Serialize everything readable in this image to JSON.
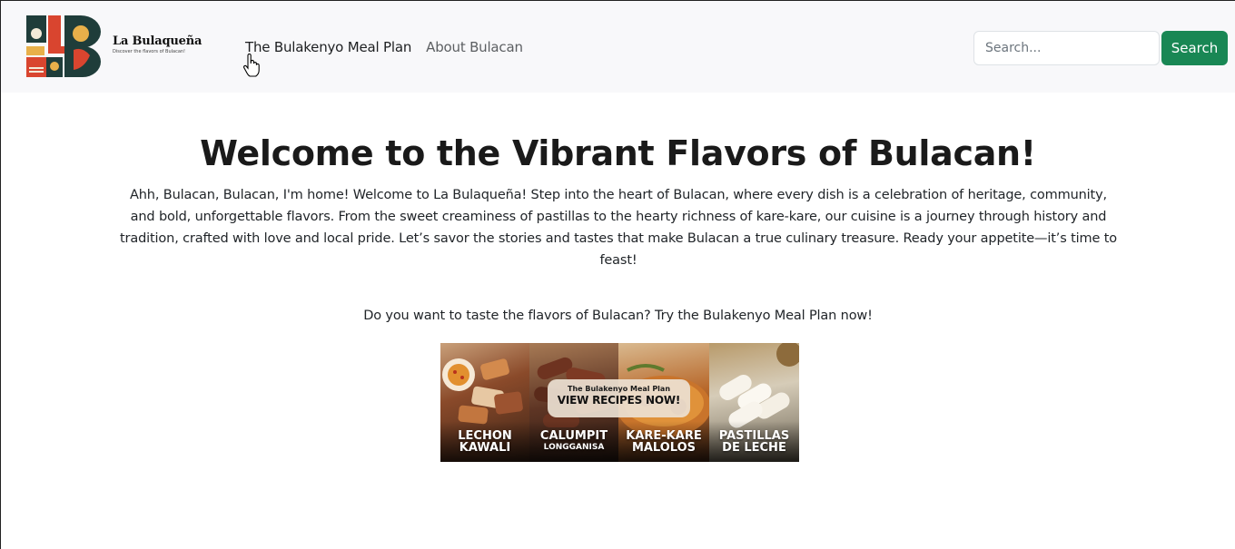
{
  "brand": {
    "name": "La Bulaqueña",
    "tagline": "Discover the flavors of Bulacan!"
  },
  "nav": {
    "links": [
      {
        "label": "The Bulakenyo Meal Plan"
      },
      {
        "label": "About Bulacan"
      }
    ]
  },
  "search": {
    "placeholder": "Search...",
    "value": "",
    "button_label": "Search"
  },
  "main": {
    "title": "Welcome to the Vibrant Flavors of Bulacan!",
    "intro": "Ahh, Bulacan, Bulacan, I'm home! Welcome to La Bulaqueña! Step into the heart of Bulacan, where every dish is a celebration of heritage, community, and bold, unforgettable flavors. From the sweet creaminess of pastillas to the hearty richness of kare-kare, our cuisine is a journey through history and tradition, crafted with love and local pride. Let’s savor the stories and tastes that make Bulacan a true culinary treasure. Ready your appetite—it’s time to feast!",
    "cta": "Do you want to taste the flavors of Bulacan? Try the Bulakenyo Meal Plan now!"
  },
  "banner": {
    "badge_top": "The Bulakenyo Meal Plan",
    "badge_main": "VIEW RECIPES NOW!",
    "panels": [
      {
        "line1": "LECHON",
        "line2": "KAWALI"
      },
      {
        "line1": "CALUMPIT",
        "line2": "LONGGANISA"
      },
      {
        "line1": "KARE-KARE",
        "line2": "MALOLOS"
      },
      {
        "line1": "PASTILLAS",
        "line2": "DE LECHE"
      }
    ]
  },
  "colors": {
    "navbar_bg": "#f8f8fa",
    "search_button": "#198754",
    "text": "#212529"
  }
}
